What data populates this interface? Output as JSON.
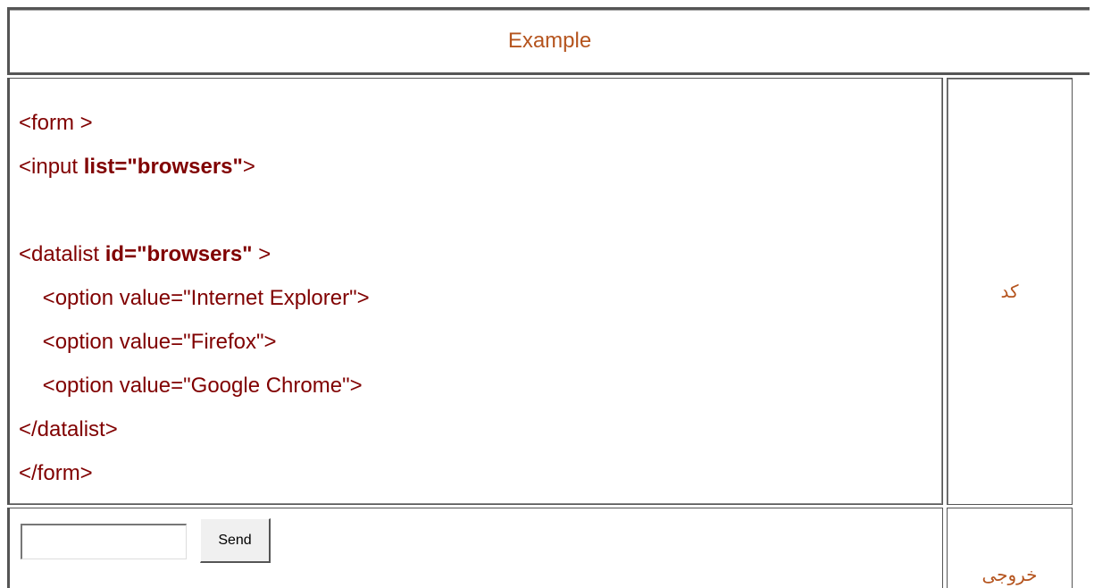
{
  "title": "Example",
  "code_label": "کد",
  "output_label": "خروجی",
  "code": {
    "line1": "<form >",
    "line2_pre": "<input ",
    "line2_bold": "list=\"browsers\"",
    "line2_post": ">",
    "line3_pre": "<datalist ",
    "line3_bold": "id=\"browsers\"",
    "line3_post": " >",
    "line4": "    <option value=\"Internet Explorer\">",
    "line5": "    <option value=\"Firefox\">",
    "line6": "    <option value=\"Google Chrome\">",
    "line7": "</datalist>",
    "line8": "</form>"
  },
  "output": {
    "input_value": "",
    "button_label": "Send"
  },
  "colors": {
    "code_text": "#800000",
    "label_text": "#b5541e"
  }
}
